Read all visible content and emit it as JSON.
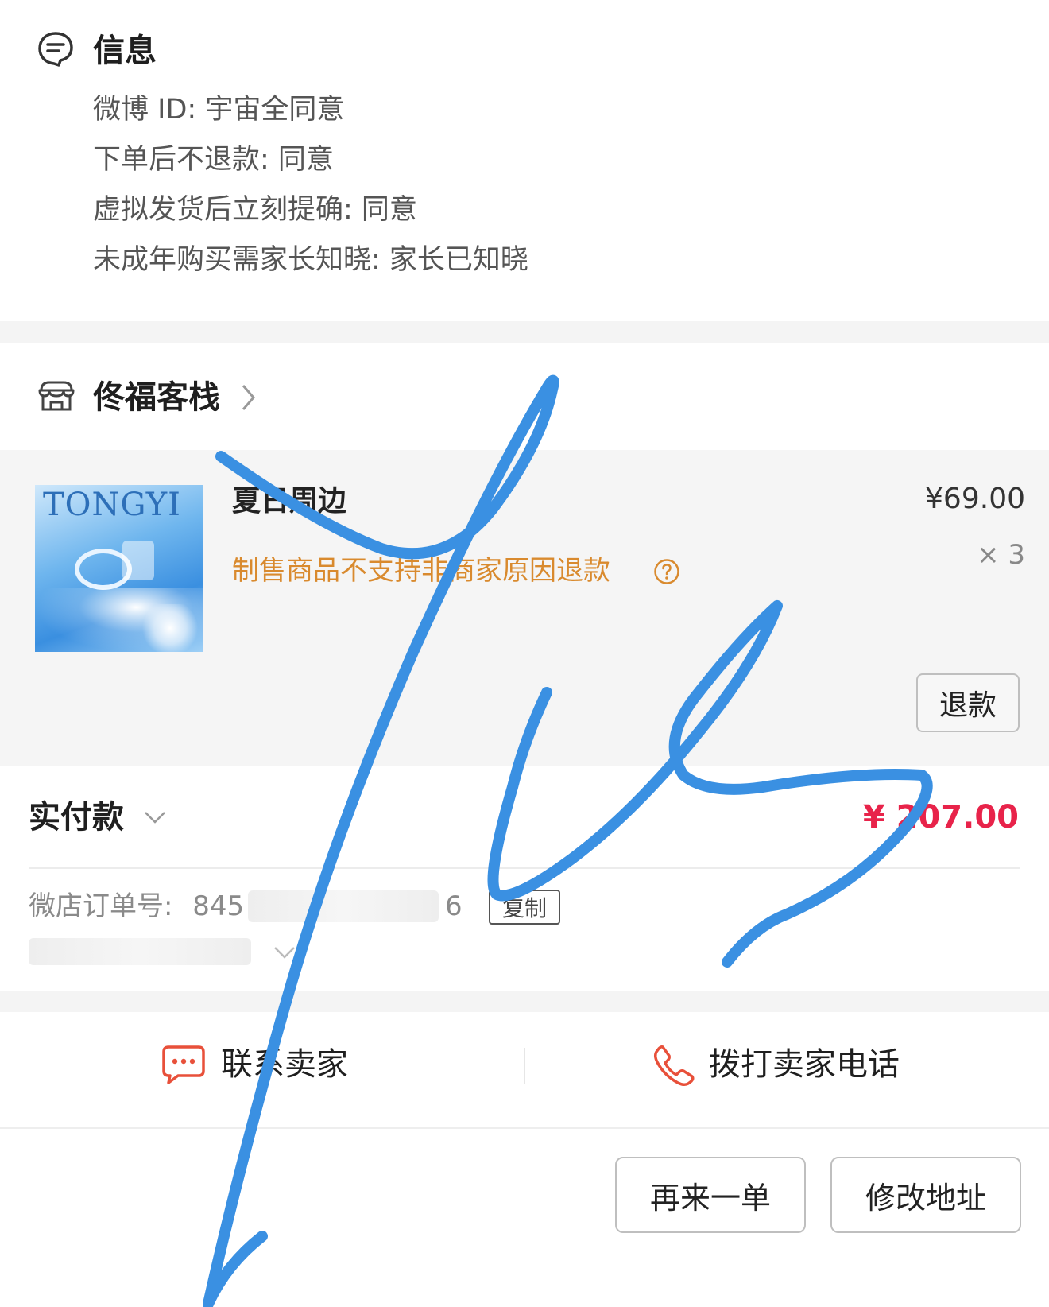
{
  "info": {
    "title": "信息",
    "lines": [
      "微博 ID: 宇宙全同意",
      "下单后不退款: 同意",
      "虚拟发货后立刻提确: 同意",
      "未成年购买需家长知晓: 家长已知晓"
    ]
  },
  "shop": {
    "name": "佟福客栈"
  },
  "product": {
    "title": "夏日周边",
    "note": "制售商品不支持非商家原因退款",
    "price": "¥69.00",
    "quantity": "× 3",
    "refund_label": "退款",
    "thumbnail_text": "TONGYI"
  },
  "payment": {
    "label": "实付款",
    "amount": "¥ 207.00",
    "amount_color": "#e8234a",
    "order_label": "微店订单号:",
    "order_visible_start": "845",
    "order_visible_end": "6",
    "copy_label": "复制"
  },
  "contact": {
    "seller_label": "联系卖家",
    "call_label": "拨打卖家电话",
    "accent": "#e8503a"
  },
  "actions": {
    "reorder_label": "再来一单",
    "edit_address_label": "修改地址"
  },
  "overlay": {
    "color": "#3a90e2"
  }
}
